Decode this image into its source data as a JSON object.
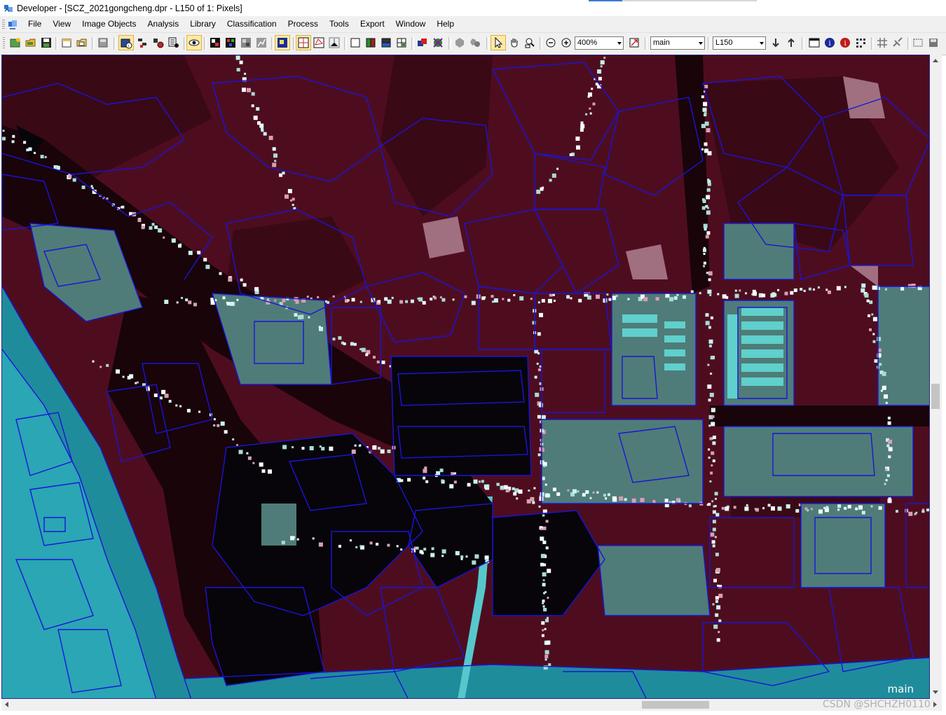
{
  "window": {
    "title": "Developer - [SCZ_2021gongcheng.dpr - L150 of 1: Pixels]"
  },
  "menu": {
    "items": [
      "File",
      "View",
      "Image Objects",
      "Analysis",
      "Library",
      "Classification",
      "Process",
      "Tools",
      "Export",
      "Window",
      "Help"
    ]
  },
  "toolbar": {
    "zoom_value": "400%",
    "process_combo_value": "main",
    "level_combo_value": "L150"
  },
  "viewer": {
    "layer_label": "main"
  },
  "watermark": {
    "text": "CSDN @SHCHZH0110"
  },
  "colors": {
    "vegetation": "#5a0f22",
    "water": "#0d0a12",
    "river": "#2aa6b4",
    "urban": "#5e8c86",
    "segment_outline": "#1a14d8",
    "bright_pixels": "#c8f2f0"
  }
}
